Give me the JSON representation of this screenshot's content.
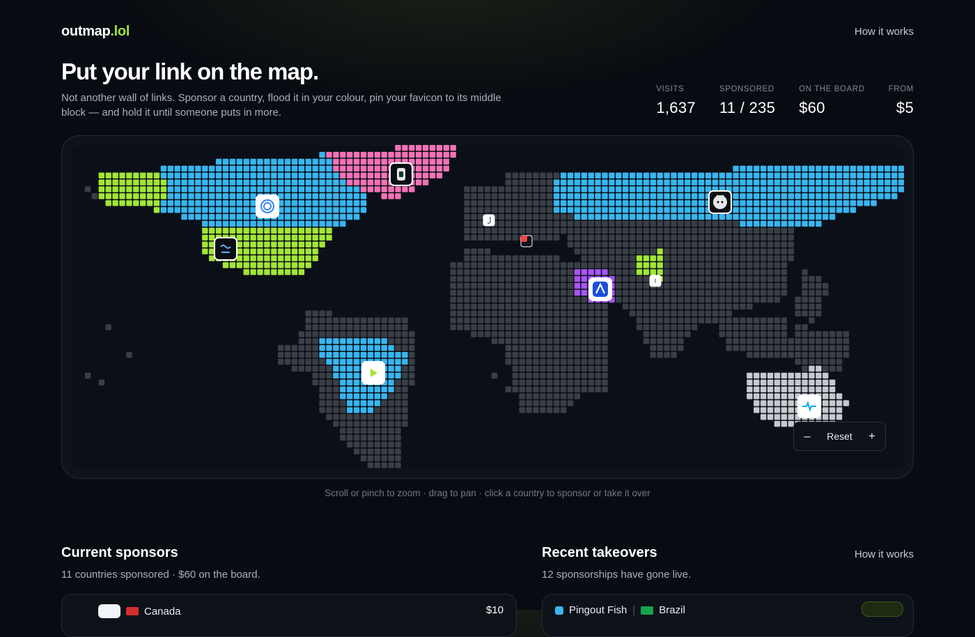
{
  "brand": {
    "name": "outmap",
    "tld": ".lol"
  },
  "nav": {
    "how_it_works": "How it works"
  },
  "hero": {
    "title": "Put your link on the map.",
    "subtitle": "Not another wall of links. Sponsor a country, flood it in your colour, pin your favicon to its middle block — and hold it until someone puts in more."
  },
  "stats": [
    {
      "label": "VISITS",
      "value": "1,637"
    },
    {
      "label": "SPONSORED",
      "value": "11 / 235"
    },
    {
      "label": "ON THE BOARD",
      "value": "$60"
    },
    {
      "label": "FROM",
      "value": "$5"
    }
  ],
  "colors": {
    "land": "#3a3f46",
    "blue": "#38b6f0",
    "green": "#a3e635",
    "pink": "#f472b6",
    "purple": "#a855f7",
    "grey": "#c6c9ce",
    "accent": "#a3e635"
  },
  "map": {
    "sponsored_countries": [
      {
        "country": "Alaska",
        "color": "green",
        "icon": "none"
      },
      {
        "country": "Canada",
        "color": "blue",
        "icon": "spiral-chat-icon"
      },
      {
        "country": "United States",
        "color": "green",
        "icon": "wave-menu-icon"
      },
      {
        "country": "Greenland",
        "color": "pink",
        "icon": "phone-app-icon"
      },
      {
        "country": "Brazil",
        "color": "blue",
        "icon": "play-arrow-icon"
      },
      {
        "country": "Russia",
        "color": "blue",
        "icon": "wolf-face-icon"
      },
      {
        "country": "Saudi Arabia",
        "color": "purple",
        "icon": "triangle-a-icon"
      },
      {
        "country": "Afghanistan",
        "color": "green",
        "icon": "small-square-icon"
      },
      {
        "country": "Australia",
        "color": "grey",
        "icon": "pulse-line-icon"
      },
      {
        "country": "Ireland",
        "color": "land",
        "icon": "letter-j-icon"
      },
      {
        "country": "Switzerland",
        "color": "land",
        "icon": "red-badge-icon"
      }
    ],
    "controls": {
      "zoom_out": "–",
      "reset": "Reset",
      "zoom_in": "+"
    }
  },
  "hint": "Scroll or pinch to zoom · drag to pan · click a country to sponsor or take it over",
  "current_sponsors": {
    "title": "Current sponsors",
    "subtitle": "11 countries sponsored · $60 on the board.",
    "first_row": {
      "country": "Canada",
      "amount": "$10"
    }
  },
  "recent_takeovers": {
    "title": "Recent takeovers",
    "link": "How it works",
    "subtitle": "12 sponsorships have gone live.",
    "first_row": {
      "name": "Pingout Fish",
      "country": "Brazil"
    }
  }
}
